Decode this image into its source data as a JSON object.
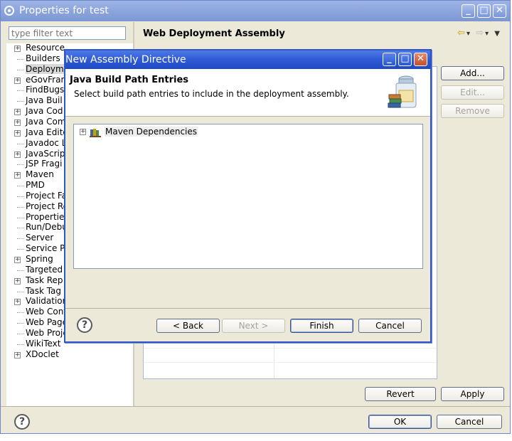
{
  "window": {
    "title": "Properties for test",
    "controls": {
      "minimize": "_",
      "maximize": "□",
      "close": "✕"
    }
  },
  "filter": {
    "placeholder": "type filter text"
  },
  "tree": {
    "items": [
      {
        "label": "Resource",
        "expandable": true
      },
      {
        "label": "Builders",
        "expandable": false
      },
      {
        "label": "Deployme",
        "expandable": false,
        "selected": true
      },
      {
        "label": "eGovFram",
        "expandable": true
      },
      {
        "label": "FindBugs",
        "expandable": false
      },
      {
        "label": "Java Buil",
        "expandable": false
      },
      {
        "label": "Java Cod",
        "expandable": true
      },
      {
        "label": "Java Com",
        "expandable": true
      },
      {
        "label": "Java Edito",
        "expandable": true
      },
      {
        "label": "Javadoc L",
        "expandable": false
      },
      {
        "label": "JavaScrip",
        "expandable": true
      },
      {
        "label": "JSP Fragi",
        "expandable": false
      },
      {
        "label": "Maven",
        "expandable": true
      },
      {
        "label": "PMD",
        "expandable": false
      },
      {
        "label": "Project Fa",
        "expandable": false
      },
      {
        "label": "Project Re",
        "expandable": false
      },
      {
        "label": "Properties",
        "expandable": false
      },
      {
        "label": "Run/Debu",
        "expandable": false
      },
      {
        "label": "Server",
        "expandable": false
      },
      {
        "label": "Service P",
        "expandable": false
      },
      {
        "label": "Spring",
        "expandable": true
      },
      {
        "label": "Targeted",
        "expandable": false
      },
      {
        "label": "Task Rep",
        "expandable": true
      },
      {
        "label": "Task Tag",
        "expandable": false
      },
      {
        "label": "Validation",
        "expandable": true
      },
      {
        "label": "Web Cont",
        "expandable": false
      },
      {
        "label": "Web Page",
        "expandable": false
      },
      {
        "label": "Web Proje",
        "expandable": false
      },
      {
        "label": "WikiText",
        "expandable": false
      },
      {
        "label": "XDoclet",
        "expandable": true
      }
    ]
  },
  "page": {
    "title": "Web Deployment Assembly",
    "nav": {
      "back": "⇦",
      "forward": "⇨",
      "dropdown": "▾",
      "menu": "▼"
    },
    "buttons": {
      "add": "Add...",
      "edit": "Edit...",
      "remove": "Remove",
      "revert": "Revert",
      "apply": "Apply"
    }
  },
  "footer": {
    "help": "?",
    "ok": "OK",
    "cancel": "Cancel"
  },
  "dialog": {
    "title": "New Assembly Directive",
    "heading": "Java Build Path Entries",
    "description": "Select build path entries to include in the deployment assembly.",
    "entries": [
      {
        "label": "Maven Dependencies",
        "icon": "library-icon"
      }
    ],
    "buttons": {
      "help": "?",
      "back": "< Back",
      "next": "Next >",
      "finish": "Finish",
      "cancel": "Cancel"
    }
  }
}
